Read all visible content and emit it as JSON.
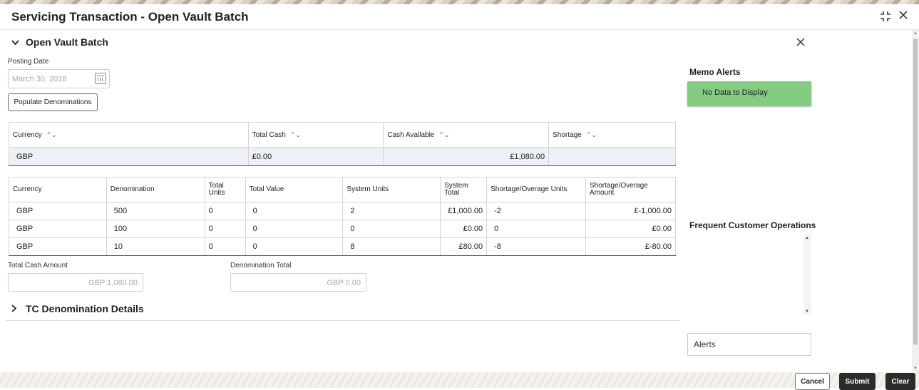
{
  "window": {
    "title": "Servicing Transaction - Open Vault Batch",
    "maximize_icon": "maximize-icon",
    "close_icon": "close-icon"
  },
  "section": {
    "title": "Open Vault Batch",
    "posting_date_label": "Posting Date",
    "posting_date_value": "March 30, 2018",
    "populate_button": "Populate Denominations"
  },
  "summary_table": {
    "headers": [
      "Currency",
      "Total Cash",
      "Cash Available",
      "Shortage"
    ],
    "rows": [
      [
        "GBP",
        "£0.00",
        "£1,080.00",
        ""
      ]
    ]
  },
  "denomination_table": {
    "headers": [
      "Currency",
      "Denomination",
      "Total Units",
      "Total Value",
      "System Units",
      "System Total",
      "Shortage/Overage Units",
      "Shortage/Overage Amount"
    ],
    "rows": [
      [
        "GBP",
        "500",
        "0",
        "0",
        "2",
        "£1,000.00",
        "-2",
        "£-1,000.00"
      ],
      [
        "GBP",
        "100",
        "0",
        "0",
        "0",
        "£0.00",
        "0",
        "£0.00"
      ],
      [
        "GBP",
        "10",
        "0",
        "0",
        "8",
        "£80.00",
        "-8",
        "£-80.00"
      ]
    ]
  },
  "totals": {
    "total_cash_label": "Total Cash Amount",
    "total_cash_value": "GBP 1,080.00",
    "denomination_total_label": "Denomination Total",
    "denomination_total_value": "GBP 0.00"
  },
  "tc_section": {
    "title": "TC Denomination Details"
  },
  "sidebar": {
    "memo_title": "Memo Alerts",
    "memo_empty": "No Data to Display",
    "fco_title": "Frequent Customer Operations",
    "alerts_label": "Alerts"
  },
  "footer": {
    "cancel": "Cancel",
    "submit": "Submit",
    "clear": "Clear"
  },
  "colors": {
    "memo_box": "#84cc82",
    "dark_button": "#2b2b2b",
    "row_highlight": "#eef0f8"
  }
}
